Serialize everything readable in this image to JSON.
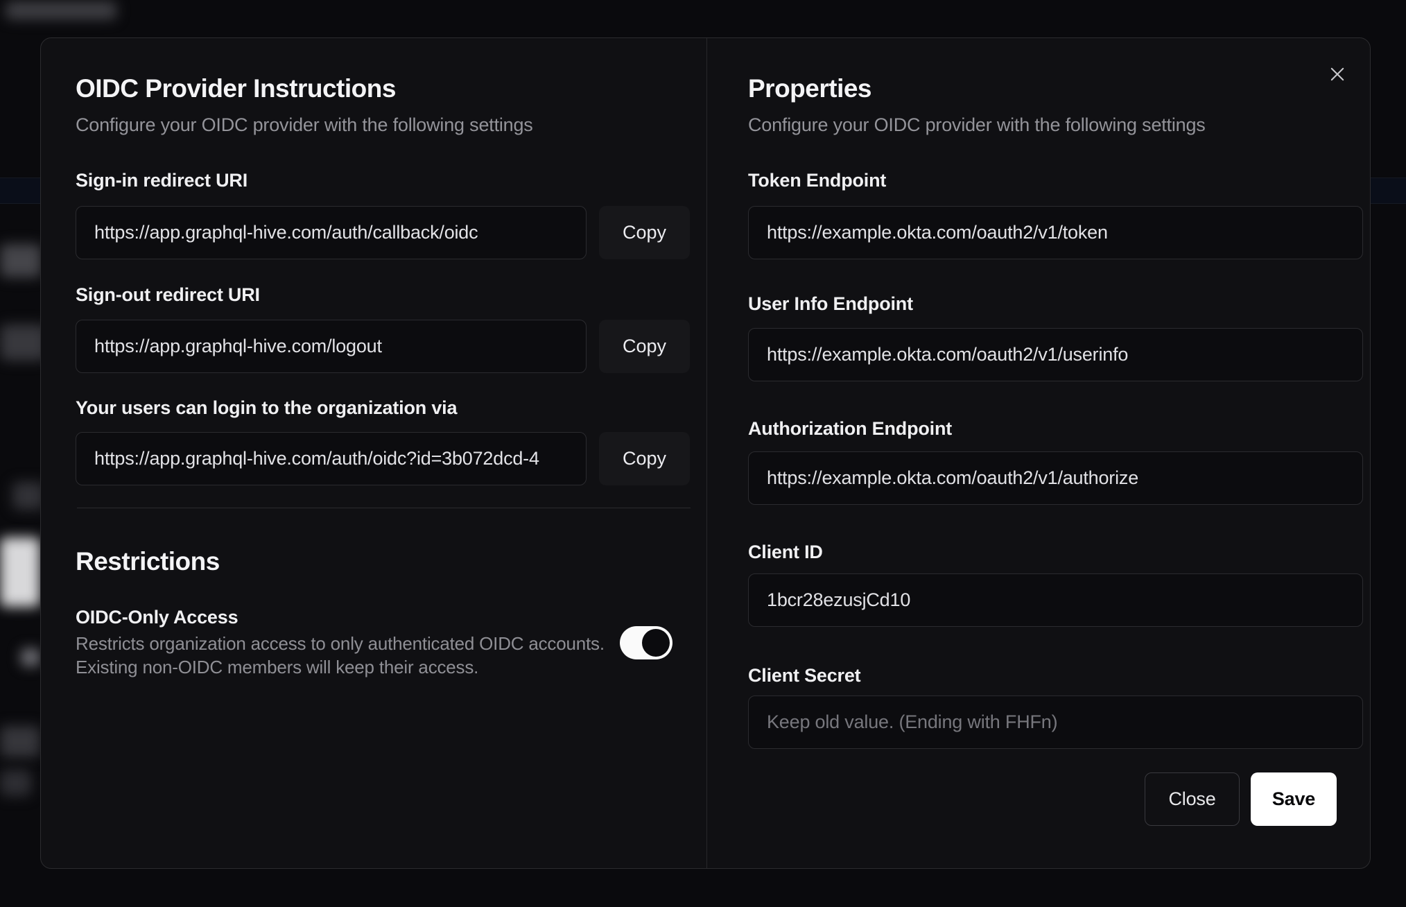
{
  "dialog": {
    "close_icon": "✕",
    "left": {
      "title": "OIDC Provider Instructions",
      "subtitle": "Configure your OIDC provider with the following settings",
      "fields": [
        {
          "label": "Sign-in redirect URI",
          "value": "https://app.graphql-hive.com/auth/callback/oidc",
          "copy_label": "Copy"
        },
        {
          "label": "Sign-out redirect URI",
          "value": "https://app.graphql-hive.com/logout",
          "copy_label": "Copy"
        },
        {
          "label": "Your users can login to the organization via",
          "value": "https://app.graphql-hive.com/auth/oidc?id=3b072dcd-4",
          "copy_label": "Copy"
        }
      ],
      "restrictions": {
        "title": "Restrictions",
        "toggle_label": "OIDC-Only Access",
        "description_line1": "Restricts organization access to only authenticated OIDC accounts.",
        "description_line2": "Existing non-OIDC members will keep their access.",
        "toggle_state": "on"
      }
    },
    "right": {
      "title": "Properties",
      "subtitle": "Configure your OIDC provider with the following settings",
      "fields": [
        {
          "label": "Token Endpoint",
          "value": "https://example.okta.com/oauth2/v1/token"
        },
        {
          "label": "User Info Endpoint",
          "value": "https://example.okta.com/oauth2/v1/userinfo"
        },
        {
          "label": "Authorization Endpoint",
          "value": "https://example.okta.com/oauth2/v1/authorize"
        },
        {
          "label": "Client ID",
          "value": "1bcr28ezusjCd10"
        },
        {
          "label": "Client Secret",
          "value": "",
          "placeholder": "Keep old value. (Ending with FHFn)"
        }
      ],
      "buttons": {
        "close": "Close",
        "save": "Save"
      }
    },
    "colors": {
      "modal_bg": "#101013",
      "save_button_bg": "#ffffff",
      "toggle_on_track": "#fafafa",
      "input_border": "#2b2b2f"
    }
  }
}
